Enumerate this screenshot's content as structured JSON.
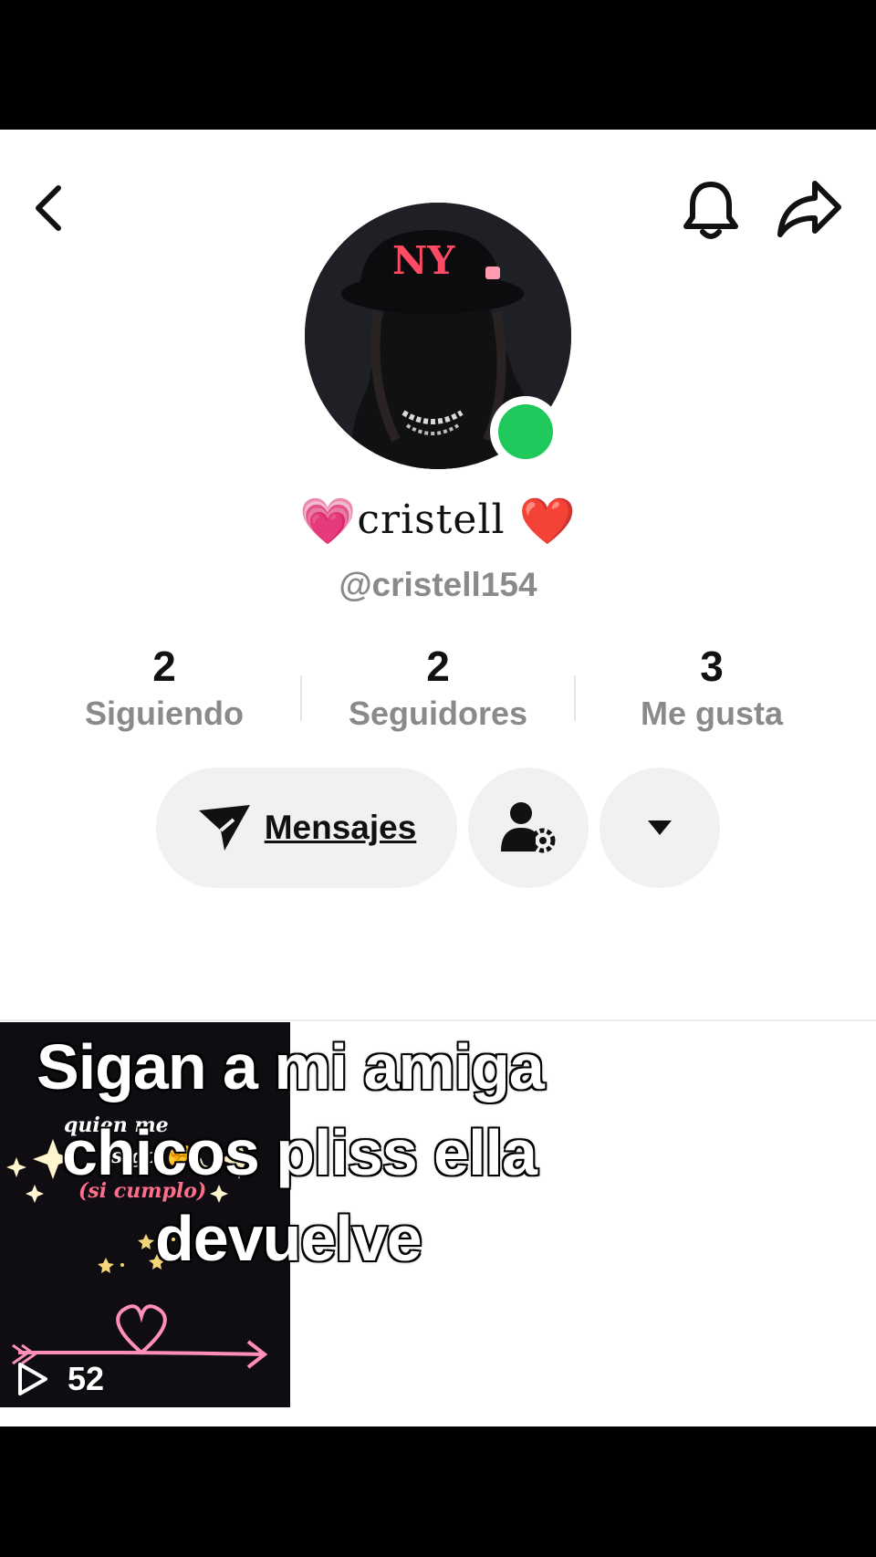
{
  "profile": {
    "display_name": "cristell",
    "name_prefix_emoji": "💗",
    "name_suffix_emoji": "❤️",
    "username": "@cristell154",
    "online": true
  },
  "stats": [
    {
      "value": "2",
      "label": "Siguiendo"
    },
    {
      "value": "2",
      "label": "Seguidores"
    },
    {
      "value": "3",
      "label": "Me gusta"
    }
  ],
  "actions": {
    "messages_label": "Mensajes"
  },
  "icons": {
    "back": "chevron-left-icon",
    "bell": "bell-icon",
    "share": "share-icon",
    "send": "send-icon",
    "user_settings": "user-settings-icon",
    "dropdown": "caret-down-icon",
    "play": "play-icon"
  },
  "videos": [
    {
      "text_line1": "quien me",
      "text_line2": "sigo ✊",
      "text_line3": "(si cumplo)",
      "views": "52"
    }
  ],
  "overlay_caption": {
    "line1": "Sigan a mi amiga",
    "line2": "chicos pliss ella",
    "line3": "devuelve"
  },
  "colors": {
    "online": "#20c95b",
    "muted_text": "#8a8a8a",
    "button_bg": "#f1f1f1"
  }
}
